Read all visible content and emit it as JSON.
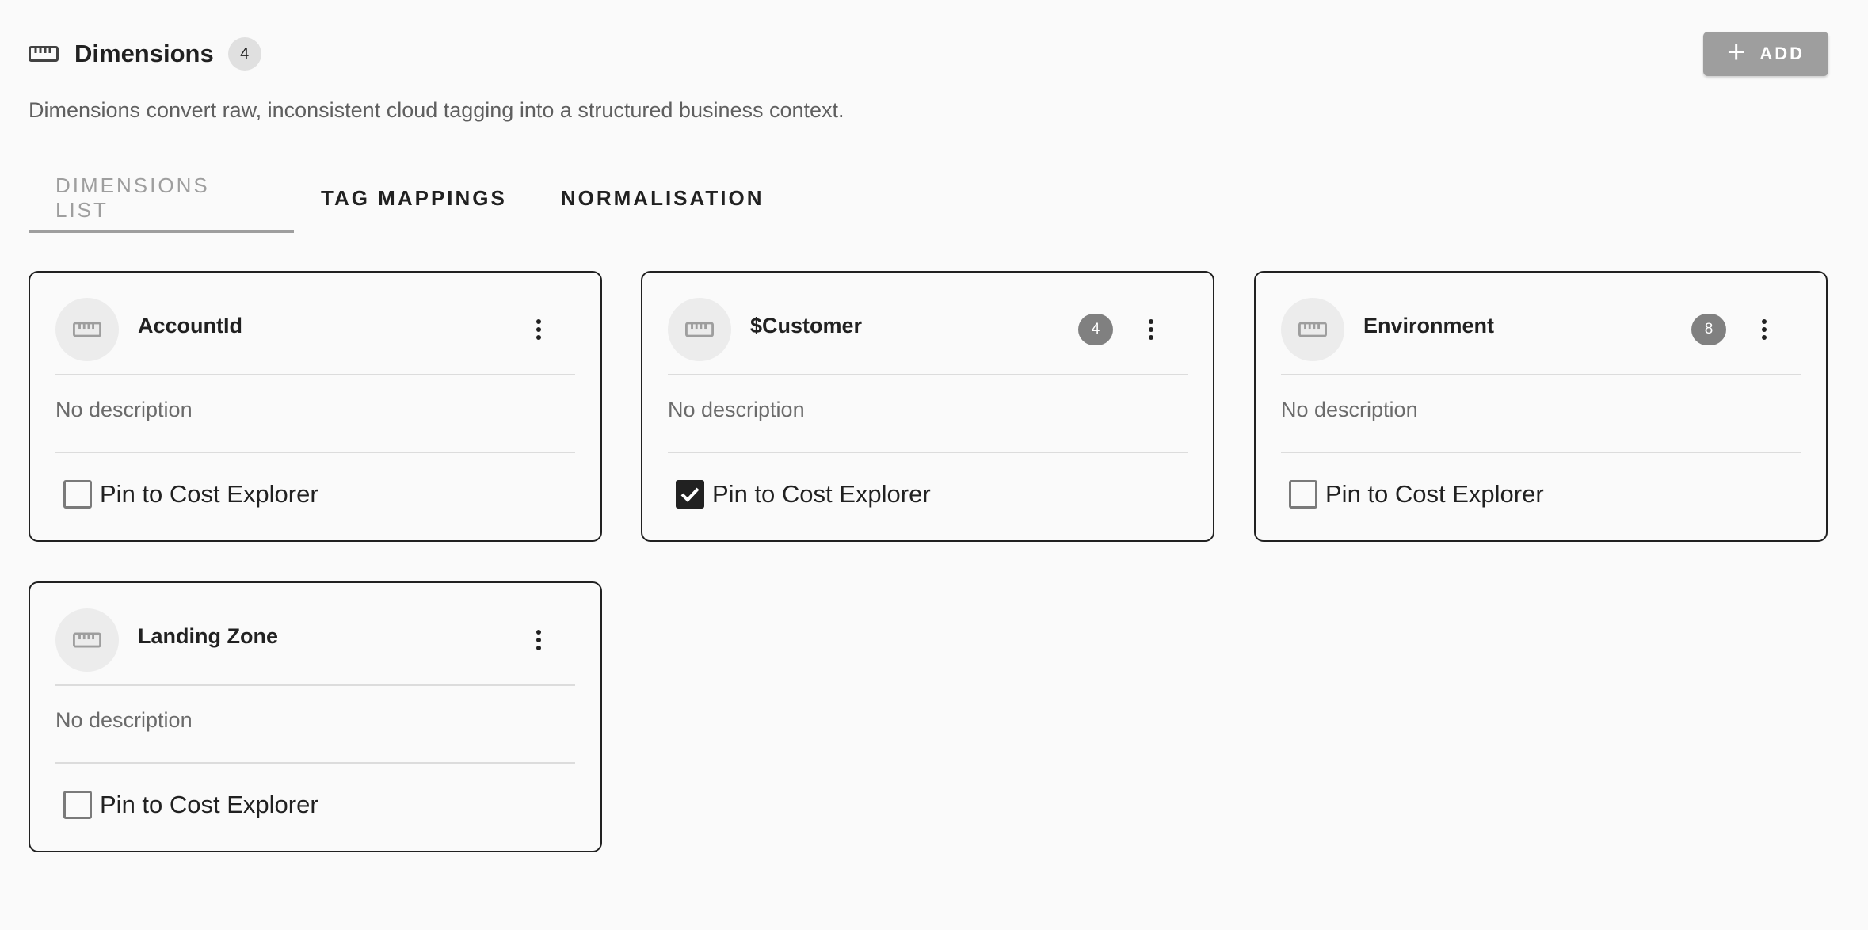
{
  "header": {
    "title": "Dimensions",
    "count": "4",
    "add_label": "ADD",
    "subtitle": "Dimensions convert raw, inconsistent cloud tagging into a structured business context."
  },
  "tabs": [
    {
      "label": "DIMENSIONS LIST",
      "active": true
    },
    {
      "label": "TAG MAPPINGS",
      "active": false
    },
    {
      "label": "NORMALISATION",
      "active": false
    }
  ],
  "cards": [
    {
      "name": "AccountId",
      "badge": "",
      "description": "No description",
      "pin_label": "Pin to Cost Explorer",
      "pinned": false
    },
    {
      "name": "$Customer",
      "badge": "4",
      "description": "No description",
      "pin_label": "Pin to Cost Explorer",
      "pinned": true
    },
    {
      "name": "Environment",
      "badge": "8",
      "description": "No description",
      "pin_label": "Pin to Cost Explorer",
      "pinned": false
    },
    {
      "name": "Landing Zone",
      "badge": "",
      "description": "No description",
      "pin_label": "Pin to Cost Explorer",
      "pinned": false
    }
  ],
  "icons": {
    "header_icon": "ruler-icon",
    "card_icon": "ruler-icon",
    "menu_icon": "more-vert-icon",
    "add_icon": "plus-icon",
    "check_icon": "check-icon"
  },
  "colors": {
    "accent_inactive": "#9e9e9e",
    "badge_bg": "#808080",
    "text": "#212121",
    "background": "#fafafa"
  }
}
